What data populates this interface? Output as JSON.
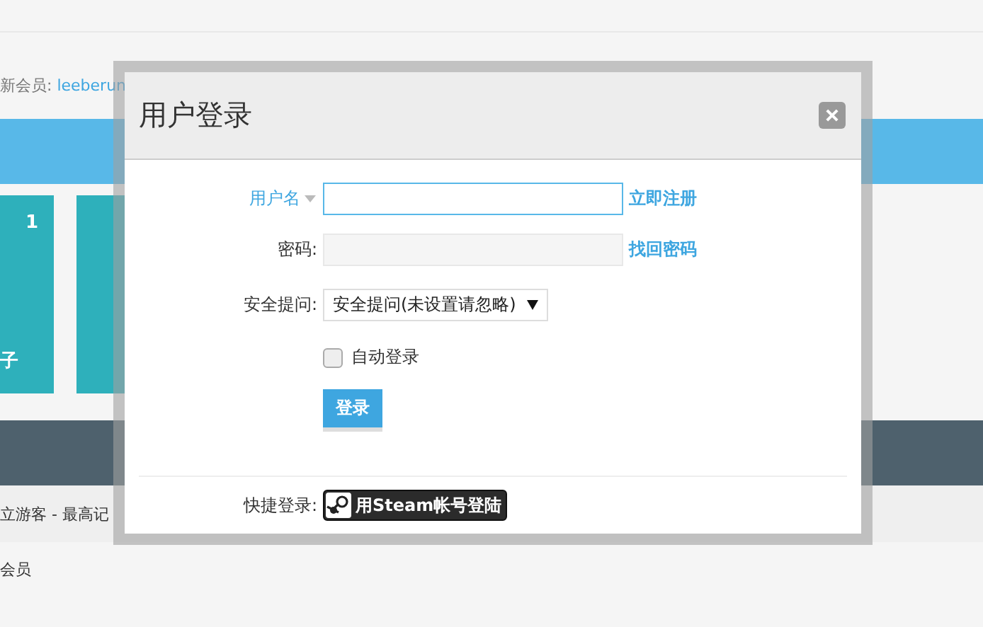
{
  "background_page": {
    "newest_member_label": "新会员:",
    "newest_member": "leeberun",
    "tiles": [
      {
        "number": "1",
        "caption": "子"
      }
    ],
    "online_text": "立游客 - 最高记",
    "members_text": "会员"
  },
  "dialog": {
    "title": "用户登录",
    "username": {
      "label": "用户名",
      "link": "立即注册"
    },
    "password": {
      "label": "密码:",
      "link": "找回密码"
    },
    "security_question": {
      "label": "安全提问:",
      "value": "安全提问(未设置请忽略)"
    },
    "auto_login": {
      "label": "自动登录",
      "checked": false
    },
    "submit": "登录",
    "quick_login": {
      "label": "快捷登录:",
      "button": "用Steam帐号登陆"
    }
  }
}
